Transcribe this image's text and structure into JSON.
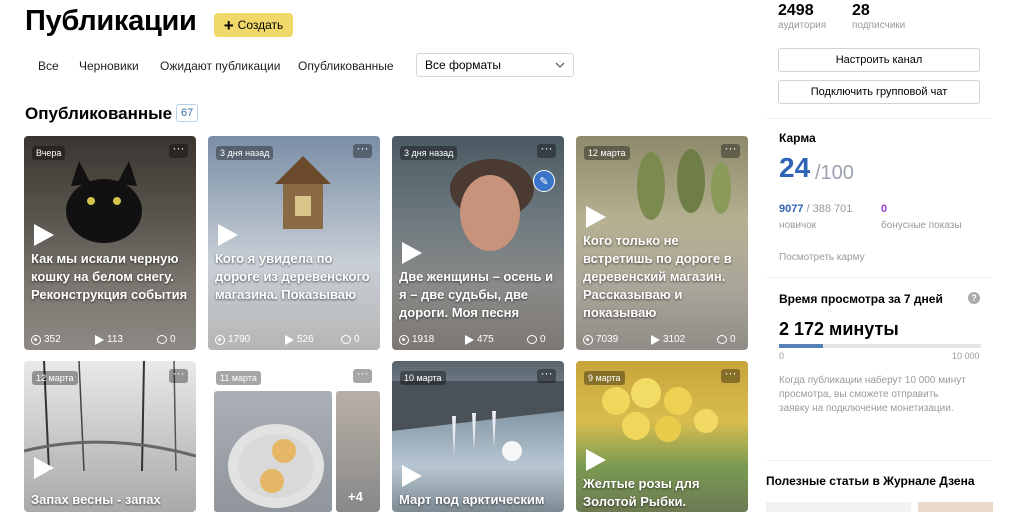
{
  "header": {
    "title": "Публикации",
    "create_label": "Создать"
  },
  "filters": {
    "tabs": [
      "Все",
      "Черновики",
      "Ожидают публикации",
      "Опубликованные"
    ],
    "format_select": "Все форматы"
  },
  "section": {
    "title": "Опубликованные",
    "count": "67"
  },
  "cards": [
    {
      "date": "Вчера",
      "title": "Как мы искали черную кошку на белом снегу. Реконструкция события",
      "views": "352",
      "plays": "113",
      "comments": "0"
    },
    {
      "date": "3 дня назад",
      "title": "Кого я увидела по дороге из деревенского магазина. Показываю",
      "views": "1790",
      "plays": "526",
      "comments": "0"
    },
    {
      "date": "3 дня назад",
      "title": "Две женщины – осень и я – две судьбы, две дороги. Моя песня",
      "views": "1918",
      "plays": "475",
      "comments": "0"
    },
    {
      "date": "12 марта",
      "title": "Кого только не встретишь по дороге в деревенский магазин. Рассказываю и показываю",
      "views": "7039",
      "plays": "3102",
      "comments": "0"
    },
    {
      "date": "12 марта",
      "title": "Запах весны - запах"
    },
    {
      "date": "11 марта",
      "extra": "+4"
    },
    {
      "date": "10 марта",
      "title": "Март под арктическим"
    },
    {
      "date": "9 марта",
      "title": "Желтые розы для Золотой Рыбки."
    }
  ],
  "sidebar": {
    "audience": {
      "value": "2498",
      "label": "аудитория"
    },
    "subscribers": {
      "value": "28",
      "label": "подписчики"
    },
    "setup_channel": "Настроить канал",
    "connect_chat": "Подключить групповой чат",
    "karma": {
      "title": "Карма",
      "value": "24",
      "max": "/100",
      "novice_value": "9077",
      "novice_total": " / 388 701",
      "novice_label": "новичок",
      "bonus_value": "0",
      "bonus_label": "бонусные показы",
      "link": "Посмотреть карму"
    },
    "watch": {
      "title": "Время просмотра за 7 дней",
      "value": "2 172 минуты",
      "scale_min": "0",
      "scale_max": "10 000",
      "progress": 0.217,
      "note": "Когда публикации наберут 10 000 минут просмотра, вы сможете отправить заявку на подключение монетизации."
    },
    "articles_title": "Полезные статьи в Журнале Дзена"
  },
  "colors": {
    "accent": "#f0d96a",
    "link": "#3b6fa6",
    "karma": "#2f63b5",
    "bonus": "#9b38c8"
  }
}
